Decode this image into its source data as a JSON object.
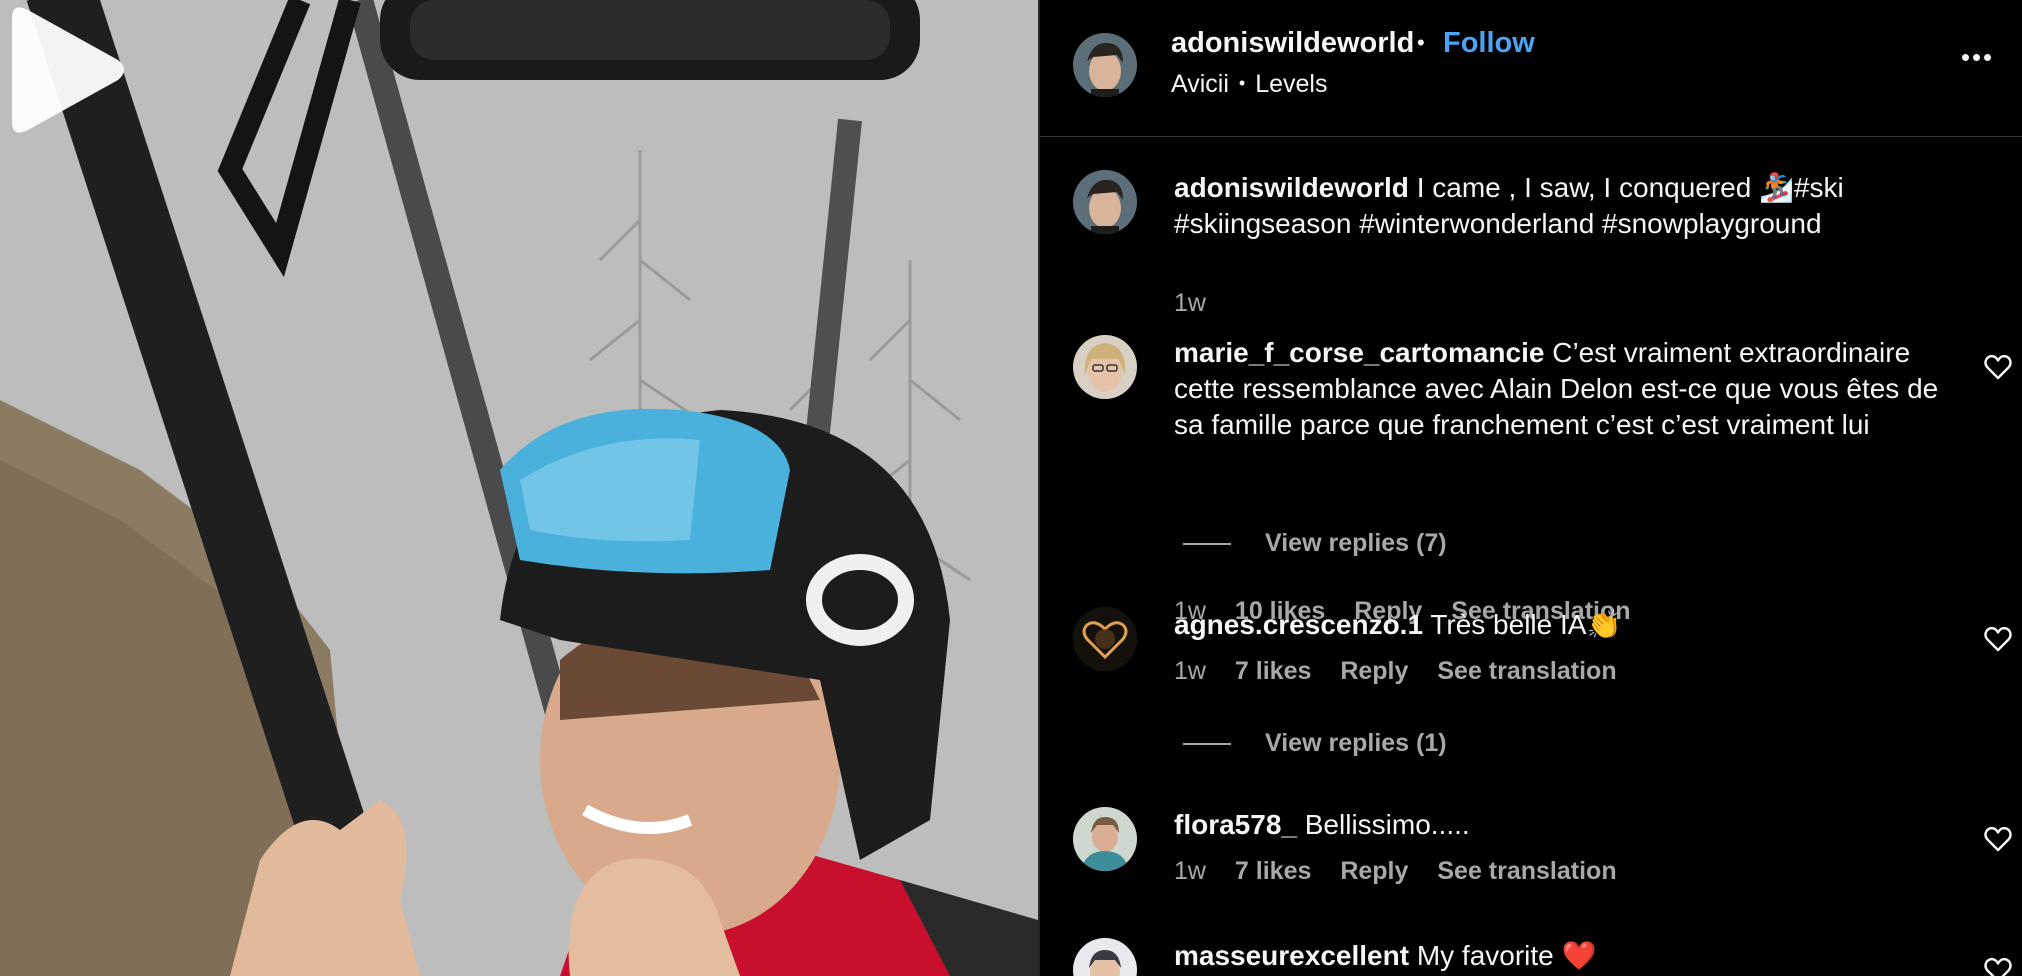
{
  "post": {
    "username": "adoniswildeworld",
    "follow_label": "Follow",
    "audio_artist": "Avicii",
    "audio_track": "Levels"
  },
  "caption": {
    "username": "adoniswildeworld",
    "text": "I came , I saw, I conquered 🏂#ski #skiingseason #winterwonderland #snowplayground",
    "time": "1w"
  },
  "comments": [
    {
      "username": "marie_f_corse_cartomancie",
      "text": "C’est vraiment extraordinaire cette ressemblance avec Alain Delon est-ce que vous êtes de sa famille parce que franchement c’est c’est vraiment lui",
      "time": "1w",
      "likes": "10 likes",
      "reply": "Reply",
      "translation": "See translation",
      "view_replies": "View replies (7)"
    },
    {
      "username": "agnes.crescenzo.1",
      "text": "Très belle IA👏",
      "time": "1w",
      "likes": "7 likes",
      "reply": "Reply",
      "translation": "See translation",
      "view_replies": "View replies (1)"
    },
    {
      "username": "flora578_",
      "text": "Bellissimo.....",
      "time": "1w",
      "likes": "7 likes",
      "reply": "Reply",
      "translation": "See translation"
    },
    {
      "username": "masseurexcellent",
      "text": "My favorite ❤️"
    }
  ],
  "icons": {
    "more": "more-options-icon",
    "heart": "heart-outline-icon",
    "play": "play-icon"
  },
  "colors": {
    "background": "#000000",
    "follow_blue": "#4aa3f5",
    "muted_text": "#a8a8a8",
    "text": "#f5f5f5"
  }
}
